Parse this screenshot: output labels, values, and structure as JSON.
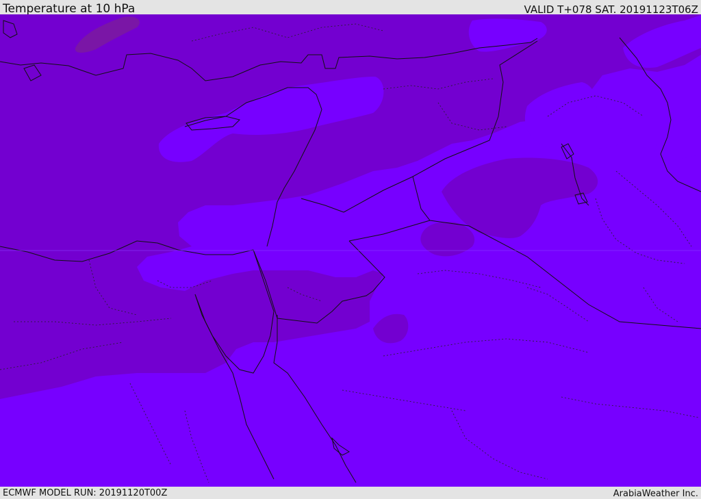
{
  "header": {
    "title": "Temperature at 10 hPa",
    "valid_time": "VALID T+078 SAT. 20191123T06Z"
  },
  "footer": {
    "model_run": "ECMWF MODEL RUN: 20191120T00Z",
    "credit": "ArabiaWeather Inc."
  },
  "map": {
    "field": "temperature",
    "level": "10 hPa",
    "colors": {
      "warm_band": "#7300d0",
      "cool_band": "#7700ff",
      "darkest_band": "#7a16a6",
      "coastline": "#111111",
      "boundaries": "#222222"
    }
  }
}
